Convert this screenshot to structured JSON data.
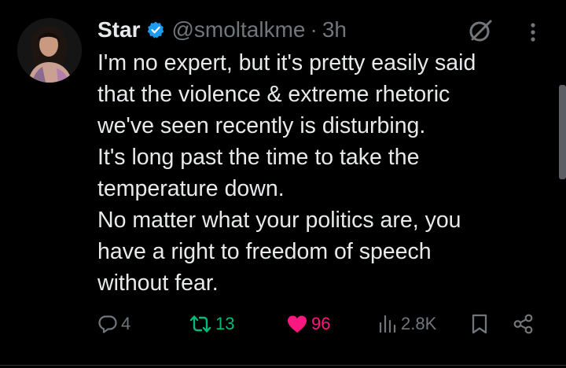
{
  "author": {
    "display_name": "Star",
    "handle": "@smoltalkme",
    "separator": "·",
    "time": "3h",
    "verified": true
  },
  "tweet": {
    "lines": [
      "I'm no expert, but it's pretty easily said",
      "that the violence & extreme rhetoric",
      "we've seen recently is disturbing.",
      "It's long past the time to take the",
      "temperature down.",
      "No matter what your politics are, you",
      "have a right to freedom of speech",
      "without fear."
    ]
  },
  "actions": {
    "reply": {
      "icon": "reply-icon",
      "count": "4"
    },
    "retweet": {
      "icon": "retweet-icon",
      "count": "13",
      "color": "#00ba7c",
      "active": true
    },
    "like": {
      "icon": "heart-icon",
      "count": "96",
      "color": "#f91880",
      "active": true
    },
    "views": {
      "icon": "views-icon",
      "count": "2.8K"
    },
    "bookmark": {
      "icon": "bookmark-icon"
    },
    "share": {
      "icon": "share-icon"
    }
  },
  "colors": {
    "background": "#000000",
    "text": "#e7e9ea",
    "muted": "#71767b",
    "verified_blue": "#1d9bf0"
  }
}
